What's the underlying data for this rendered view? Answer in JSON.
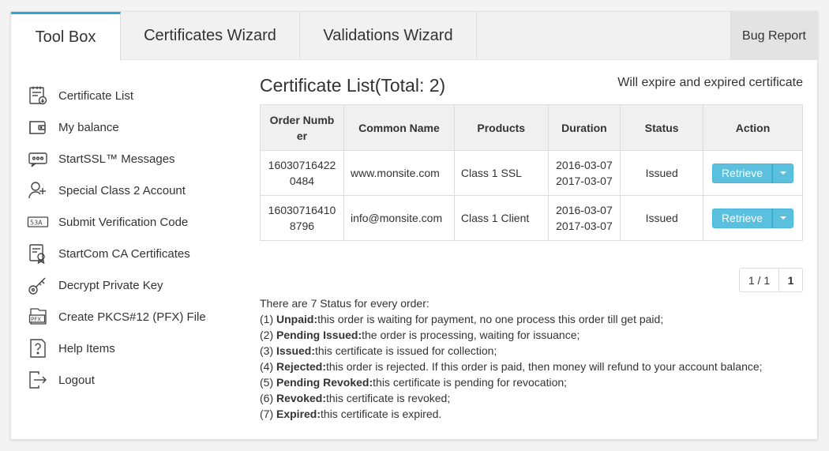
{
  "tabs": [
    {
      "label": "Tool Box"
    },
    {
      "label": "Certificates Wizard"
    },
    {
      "label": "Validations Wizard"
    },
    {
      "label": "Bug Report"
    }
  ],
  "sidebar": {
    "items": [
      {
        "label": "Certificate List",
        "icon": "certificate-list-icon"
      },
      {
        "label": "My balance",
        "icon": "wallet-icon"
      },
      {
        "label": "StartSSL™ Messages",
        "icon": "messages-icon"
      },
      {
        "label": "Special Class 2 Account",
        "icon": "add-user-icon"
      },
      {
        "label": "Submit Verification Code",
        "icon": "verification-code-icon"
      },
      {
        "label": "StartCom CA Certificates",
        "icon": "ca-certificate-icon"
      },
      {
        "label": "Decrypt Private Key",
        "icon": "key-icon"
      },
      {
        "label": "Create PKCS#12 (PFX) File",
        "icon": "pfx-file-icon"
      },
      {
        "label": "Help Items",
        "icon": "help-icon"
      },
      {
        "label": "Logout",
        "icon": "logout-icon"
      }
    ]
  },
  "main": {
    "title": "Certificate List(Total: 2)",
    "expire_link": "Will expire and expired certificate",
    "table": {
      "headers": [
        "Order Numb er",
        "Common Name",
        "Products",
        "Duration",
        "Status",
        "Action"
      ],
      "rows": [
        {
          "order_a": "16030716422",
          "order_b": "0484",
          "common_name": "www.monsite.com",
          "product": "Class 1 SSL",
          "start": "2016-03-07",
          "end": "2017-03-07",
          "status": "Issued",
          "action": "Retrieve"
        },
        {
          "order_a": "16030716410",
          "order_b": "8796",
          "common_name": "info@monsite.com",
          "product": "Class 1 Client",
          "start": "2016-03-07",
          "end": "2017-03-07",
          "status": "Issued",
          "action": "Retrieve"
        }
      ]
    },
    "pager": {
      "info": "1 / 1",
      "page": "1"
    },
    "status_intro": "There are 7 Status for every order:",
    "statuses": [
      {
        "num": "(1) ",
        "name": "Unpaid:",
        "desc": "this order is waiting for payment, no one process this order till get paid;"
      },
      {
        "num": "(2) ",
        "name": "Pending Issued:",
        "desc": "the order is processing, waiting for issuance;"
      },
      {
        "num": "(3) ",
        "name": "Issued:",
        "desc": "this certificate is issued for collection;"
      },
      {
        "num": "(4) ",
        "name": "Rejected:",
        "desc": "this order is rejected. If this order is paid, then money will refund to your account balance;"
      },
      {
        "num": "(5) ",
        "name": "Pending Revoked:",
        "desc": "this certificate is pending for revocation;"
      },
      {
        "num": "(6) ",
        "name": "Revoked:",
        "desc": "this certificate is revoked;"
      },
      {
        "num": "(7) ",
        "name": "Expired:",
        "desc": "this certificate is expired."
      }
    ]
  },
  "colors": {
    "accent": "#2aa7d8",
    "button": "#5bc0de"
  }
}
